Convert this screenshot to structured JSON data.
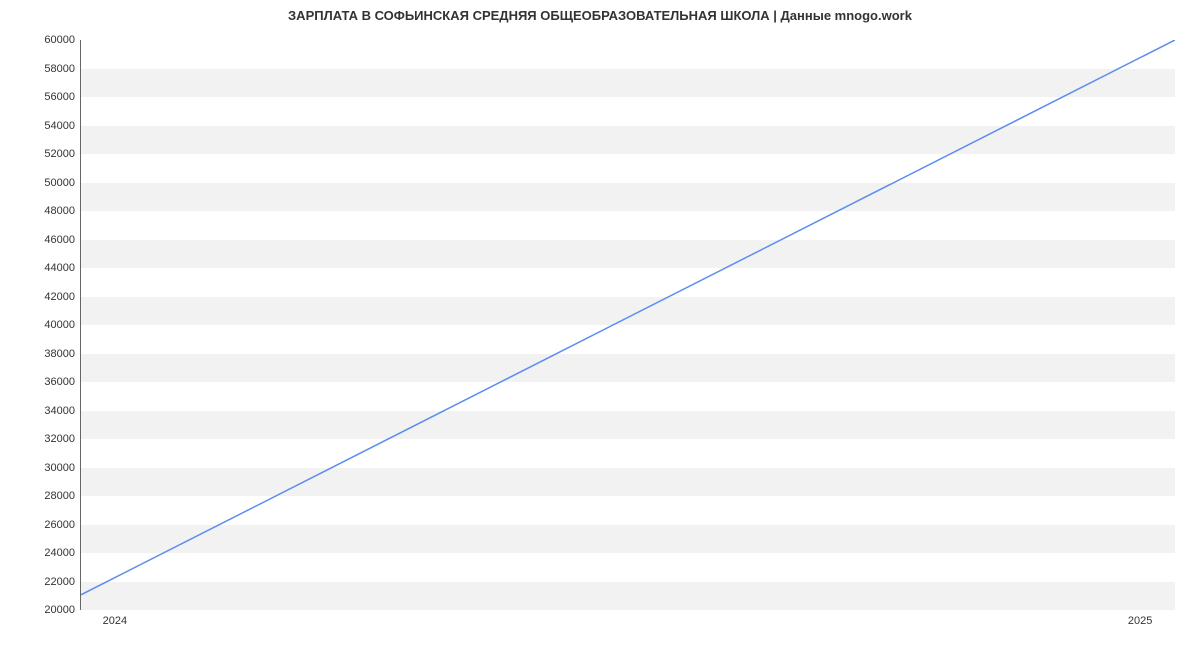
{
  "chart_data": {
    "type": "line",
    "title": "ЗАРПЛАТА В СОФЬИНСКАЯ СРЕДНЯЯ ОБЩЕОБРАЗОВАТЕЛЬНАЯ ШКОЛА | Данные mnogo.work",
    "xlabel": "",
    "ylabel": "",
    "x_ticks": [
      "2024",
      "2025"
    ],
    "y_ticks": [
      20000,
      22000,
      24000,
      26000,
      28000,
      30000,
      32000,
      34000,
      36000,
      38000,
      40000,
      42000,
      44000,
      46000,
      48000,
      50000,
      52000,
      54000,
      56000,
      58000,
      60000
    ],
    "ylim": [
      20000,
      60000
    ],
    "series": [
      {
        "name": "salary",
        "color": "#5b8def",
        "x": [
          "2024",
          "2025"
        ],
        "values": [
          21000,
          60000
        ]
      }
    ]
  }
}
